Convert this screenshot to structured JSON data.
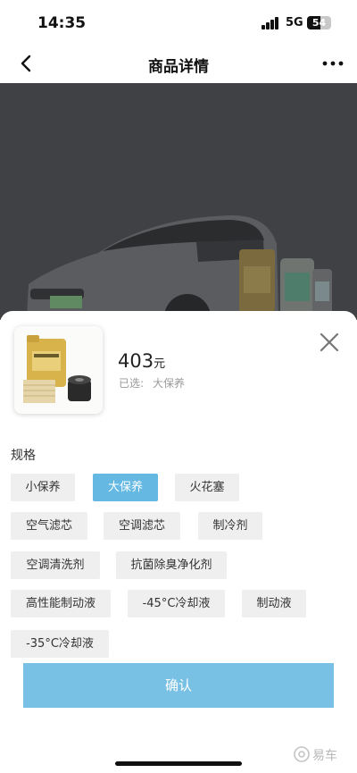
{
  "status_bar": {
    "time": "14:35",
    "network": "5G",
    "battery": "54",
    "battery_level_percent": 54
  },
  "nav": {
    "title": "商品详情",
    "back_icon": "chevron-left-icon",
    "more_icon": "more-horizontal-icon"
  },
  "hero": {
    "image": "car-and-maintenance-products-photo"
  },
  "product": {
    "price": "403",
    "currency_unit": "元",
    "selected_label": "已选:",
    "selected_value": "大保养",
    "thumbnail": "engine-oil-and-filters-photo"
  },
  "spec": {
    "title": "规格",
    "options": [
      {
        "label": "小保养",
        "active": false
      },
      {
        "label": "大保养",
        "active": true
      },
      {
        "label": "火花塞",
        "active": false
      },
      {
        "label": "空气滤芯",
        "active": false
      },
      {
        "label": "空调滤芯",
        "active": false
      },
      {
        "label": "制冷剂",
        "active": false
      },
      {
        "label": "空调清洗剂",
        "active": false
      },
      {
        "label": "抗菌除臭净化剂",
        "active": false
      },
      {
        "label": "高性能制动液",
        "active": false
      },
      {
        "label": "-45°C冷却液",
        "active": false
      },
      {
        "label": "制动液",
        "active": false
      },
      {
        "label": "-35°C冷却液",
        "active": false
      }
    ]
  },
  "confirm_label": "确认",
  "watermark": "易车",
  "colors": {
    "accent": "#64b8e2",
    "confirm": "#78c0e4",
    "chip_bg": "#efefef",
    "hero_overlay": "#3f4144"
  }
}
